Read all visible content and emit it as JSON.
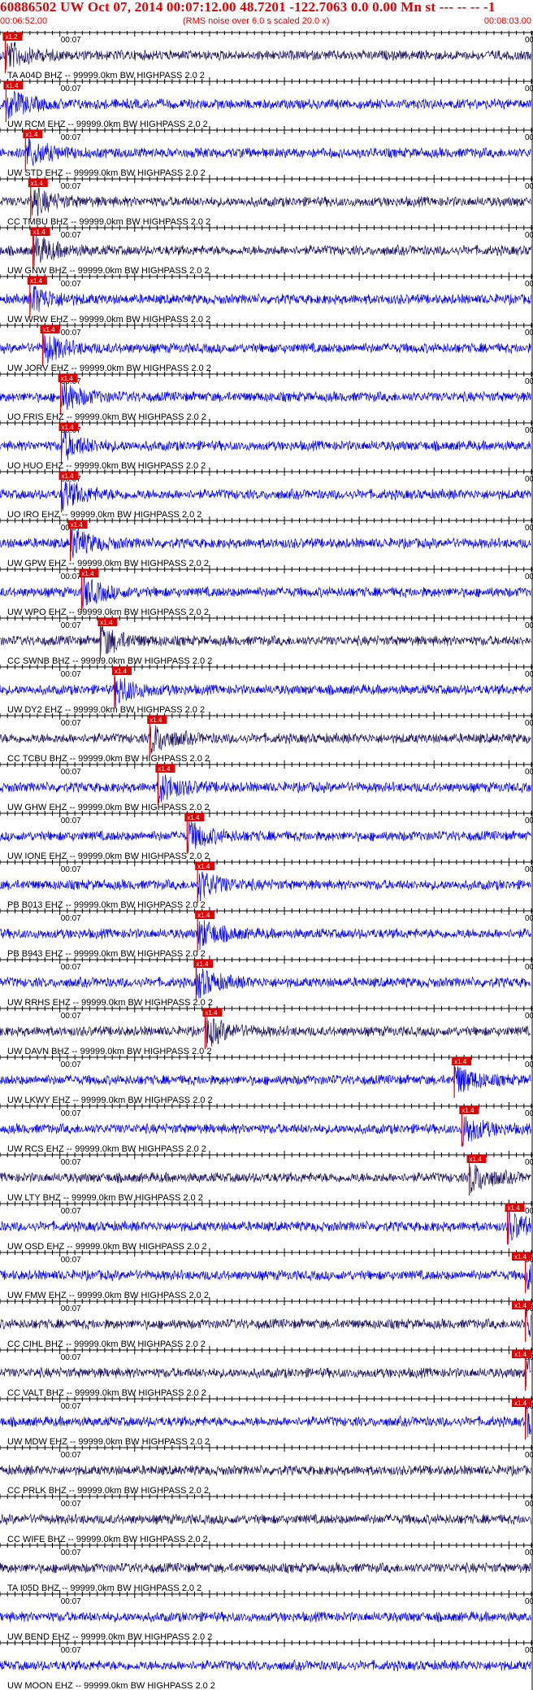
{
  "header": {
    "title": "60886502 UW Oct 07, 2014 00:07:12.00   48.7201 -122.7063  0.0 0.00 Mn st --- -- --  -1",
    "start_time": "00:06:52.00",
    "rms_note": "(RMS noise over 6.0 s scaled 20.0 x)",
    "end_time": "00:08:03.00"
  },
  "colors": {
    "header_text": "#e00000",
    "trace_blue": "#0000ee",
    "trace_navy": "#1a1060",
    "pick": "#e00000",
    "axis": "#000000"
  },
  "chart_data": {
    "type": "line",
    "x_range": [
      "00:06:52.00",
      "00:08:03.00"
    ],
    "tick_label": "00:07",
    "filter_suffix": "-- 99999.0km BW  HIGHPASS  2.0  2",
    "traces": [
      {
        "station": "TA A04D BHZ",
        "pick": "00:06:52.7",
        "pick_label": "x1.2",
        "color": "navy"
      },
      {
        "station": "UW RCM EHZ",
        "pick": "00:06:52.8",
        "pick_label": "x1.4",
        "color": "blue"
      },
      {
        "station": "UW STD EHZ",
        "pick": "00:06:55.4",
        "pick_label": "x1.4",
        "color": "blue"
      },
      {
        "station": "CC TMBU BHZ",
        "pick": "00:06:56.1",
        "pick_label": "x1.4",
        "color": "navy"
      },
      {
        "station": "UW GNW BHZ",
        "pick": "00:06:56.4",
        "pick_label": "x1.4",
        "color": "navy"
      },
      {
        "station": "UW WRW EHZ",
        "pick": "00:06:56.0",
        "pick_label": "x1.4",
        "color": "blue"
      },
      {
        "station": "UW JORV EHZ",
        "pick": "00:06:57.7",
        "pick_label": "x1.4",
        "color": "blue"
      },
      {
        "station": "UO FRIS EHZ",
        "pick": "00:07:00.1",
        "pick_label": "x1.4",
        "color": "blue"
      },
      {
        "station": "UO HUO EHZ",
        "pick": "00:07:00.2",
        "pick_label": "x1.4",
        "color": "blue"
      },
      {
        "station": "UO IRO EHZ",
        "pick": "00:07:00.2",
        "pick_label": "x1.4",
        "color": "blue"
      },
      {
        "station": "UW GPW EHZ",
        "pick": "00:07:01.4",
        "pick_label": "x1.4",
        "color": "blue"
      },
      {
        "station": "UW WPO EHZ",
        "pick": "00:07:02.9",
        "pick_label": "x1.4",
        "color": "blue"
      },
      {
        "station": "CC SWNB BHZ",
        "pick": "00:07:05.4",
        "pick_label": "x1.4",
        "color": "navy"
      },
      {
        "station": "UW DY2 EHZ",
        "pick": "00:07:07.3",
        "pick_label": "x1.4",
        "color": "blue"
      },
      {
        "station": "CC TCBU BHZ",
        "pick": "00:07:12.0",
        "pick_label": "x1.4",
        "color": "navy"
      },
      {
        "station": "UW GHW EHZ",
        "pick": "00:07:13.1",
        "pick_label": "x1.4",
        "color": "blue"
      },
      {
        "station": "UW IONE EHZ",
        "pick": "00:07:17.0",
        "pick_label": "x1.4",
        "color": "blue"
      },
      {
        "station": "PB B013 EHZ",
        "pick": "00:07:18.4",
        "pick_label": "x1.4",
        "color": "blue"
      },
      {
        "station": "PB B943 EHZ",
        "pick": "00:07:18.4",
        "pick_label": "x1.4",
        "color": "blue"
      },
      {
        "station": "UW RRHS EHZ",
        "pick": "00:07:18.2",
        "pick_label": "x1.4",
        "color": "blue"
      },
      {
        "station": "UW DAVN BHZ",
        "pick": "00:07:19.4",
        "pick_label": "x1.4",
        "color": "navy"
      },
      {
        "station": "UW LKWY EHZ",
        "pick": "00:07:52.7",
        "pick_label": "x1.4",
        "color": "blue"
      },
      {
        "station": "UW RCS EHZ",
        "pick": "00:07:53.7",
        "pick_label": "x1.4",
        "color": "blue"
      },
      {
        "station": "UW LTY BHZ",
        "pick": "00:07:54.7",
        "pick_label": "x1.4",
        "color": "navy"
      },
      {
        "station": "UW OSD EHZ",
        "pick": "00:07:59.8",
        "pick_label": "x1.4",
        "color": "blue"
      },
      {
        "station": "UW FMW EHZ",
        "pick": "00:08:02.2",
        "pick_label": "x1.4",
        "color": "blue"
      },
      {
        "station": "CC CIHL BHZ",
        "pick": "00:08:02.2",
        "pick_label": "x1.4",
        "color": "navy"
      },
      {
        "station": "CC VALT BHZ",
        "pick": "00:08:02.2",
        "pick_label": "x1.4",
        "color": "navy"
      },
      {
        "station": "UW MDW EHZ",
        "pick": "00:08:02.2",
        "pick_label": "x1.4",
        "color": "blue"
      },
      {
        "station": "CC PRLK BHZ",
        "pick": "",
        "pick_label": "",
        "color": "navy"
      },
      {
        "station": "CC WIFE BHZ",
        "pick": "",
        "pick_label": "",
        "color": "navy"
      },
      {
        "station": "TA I05D BHZ",
        "pick": "",
        "pick_label": "",
        "color": "navy"
      },
      {
        "station": "UW BEND EHZ",
        "pick": "",
        "pick_label": "",
        "color": "blue"
      },
      {
        "station": "UW MOON EHZ",
        "pick": "",
        "pick_label": "",
        "color": "blue"
      }
    ]
  }
}
